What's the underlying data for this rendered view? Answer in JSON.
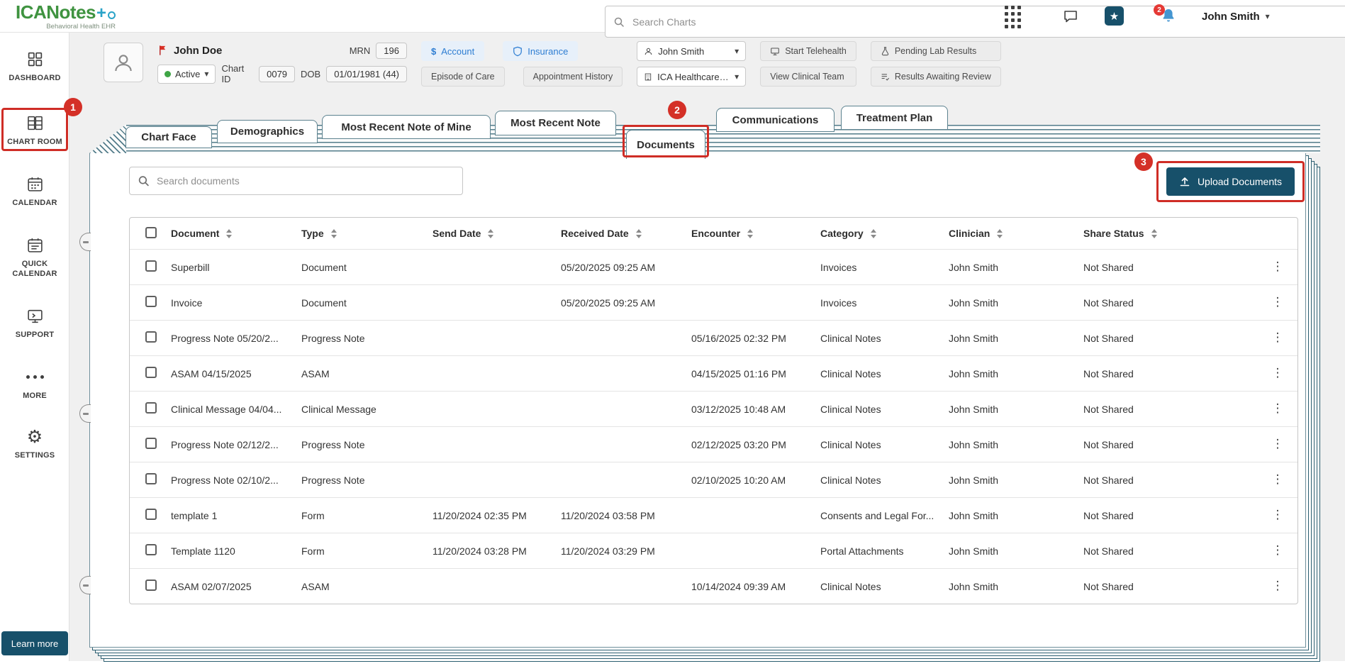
{
  "topbar": {
    "logo_text": "ICANotes",
    "logo_plus": "+",
    "logo_subtitle": "Behavioral Health EHR",
    "search_placeholder": "Search Charts",
    "notification_badge": "2",
    "user_name": "John Smith"
  },
  "sidebar": {
    "items": [
      {
        "label": "DASHBOARD"
      },
      {
        "label": "CHART ROOM"
      },
      {
        "label": "CALENDAR"
      },
      {
        "label": "QUICK CALENDAR"
      },
      {
        "label": "SUPPORT"
      },
      {
        "label": "MORE"
      },
      {
        "label": "SETTINGS"
      }
    ],
    "learn_more_label": "Learn more"
  },
  "patient_header": {
    "name": "John Doe",
    "status": "Active",
    "mrn_label": "MRN",
    "mrn": "196",
    "chart_id_label": "Chart ID",
    "chart_id": "0079",
    "dob_label": "DOB",
    "dob": "01/01/1981 (44)",
    "account_label": "Account",
    "insurance_label": "Insurance",
    "episode_of_care_label": "Episode of Care",
    "appointment_history_label": "Appointment History",
    "provider_select": "John Smith",
    "office_select": "ICA Healthcare Offi",
    "start_telehealth_label": "Start Telehealth",
    "view_clinical_team_label": "View Clinical Team",
    "pending_lab_results_label": "Pending Lab Results",
    "results_awaiting_review_label": "Results Awaiting Review"
  },
  "tabs": [
    {
      "label": "Chart Face"
    },
    {
      "label": "Demographics"
    },
    {
      "label": "Most Recent Note of Mine"
    },
    {
      "label": "Most Recent Note"
    },
    {
      "label": "Documents",
      "selected": true
    },
    {
      "label": "Communications"
    },
    {
      "label": "Treatment Plan"
    }
  ],
  "documents_panel": {
    "search_placeholder": "Search documents",
    "upload_button_label": "Upload Documents",
    "columns": [
      "Document",
      "Type",
      "Send Date",
      "Received Date",
      "Encounter",
      "Category",
      "Clinician",
      "Share Status"
    ],
    "rows": [
      {
        "document": "Superbill",
        "type": "Document",
        "send_date": "",
        "received_date": "05/20/2025 09:25 AM",
        "encounter": "",
        "category": "Invoices",
        "clinician": "John Smith",
        "share_status": "Not Shared"
      },
      {
        "document": "Invoice",
        "type": "Document",
        "send_date": "",
        "received_date": "05/20/2025 09:25 AM",
        "encounter": "",
        "category": "Invoices",
        "clinician": "John Smith",
        "share_status": "Not Shared"
      },
      {
        "document": "Progress Note 05/20/2...",
        "type": "Progress Note",
        "send_date": "",
        "received_date": "",
        "encounter": "05/16/2025 02:32 PM",
        "category": "Clinical Notes",
        "clinician": "John Smith",
        "share_status": "Not Shared"
      },
      {
        "document": "ASAM 04/15/2025",
        "type": "ASAM",
        "send_date": "",
        "received_date": "",
        "encounter": "04/15/2025 01:16 PM",
        "category": "Clinical Notes",
        "clinician": "John Smith",
        "share_status": "Not Shared"
      },
      {
        "document": "Clinical Message 04/04...",
        "type": "Clinical Message",
        "send_date": "",
        "received_date": "",
        "encounter": "03/12/2025 10:48 AM",
        "category": "Clinical Notes",
        "clinician": "John Smith",
        "share_status": "Not Shared"
      },
      {
        "document": "Progress Note 02/12/2...",
        "type": "Progress Note",
        "send_date": "",
        "received_date": "",
        "encounter": "02/12/2025 03:20 PM",
        "category": "Clinical Notes",
        "clinician": "John Smith",
        "share_status": "Not Shared"
      },
      {
        "document": "Progress Note 02/10/2...",
        "type": "Progress Note",
        "send_date": "",
        "received_date": "",
        "encounter": "02/10/2025 10:20 AM",
        "category": "Clinical Notes",
        "clinician": "John Smith",
        "share_status": "Not Shared"
      },
      {
        "document": "template 1",
        "type": "Form",
        "send_date": "11/20/2024 02:35 PM",
        "received_date": "11/20/2024 03:58 PM",
        "encounter": "",
        "category": "Consents and Legal For...",
        "clinician": "John Smith",
        "share_status": "Not Shared"
      },
      {
        "document": "Template 1120",
        "type": "Form",
        "send_date": "11/20/2024 03:28 PM",
        "received_date": "11/20/2024 03:29 PM",
        "encounter": "",
        "category": "Portal Attachments",
        "clinician": "John Smith",
        "share_status": "Not Shared"
      },
      {
        "document": "ASAM 02/07/2025",
        "type": "ASAM",
        "send_date": "",
        "received_date": "",
        "encounter": "10/14/2024 09:39 AM",
        "category": "Clinical Notes",
        "clinician": "John Smith",
        "share_status": "Not Shared"
      }
    ]
  },
  "annotations": {
    "step1": "1",
    "step2": "2",
    "step3": "3"
  }
}
